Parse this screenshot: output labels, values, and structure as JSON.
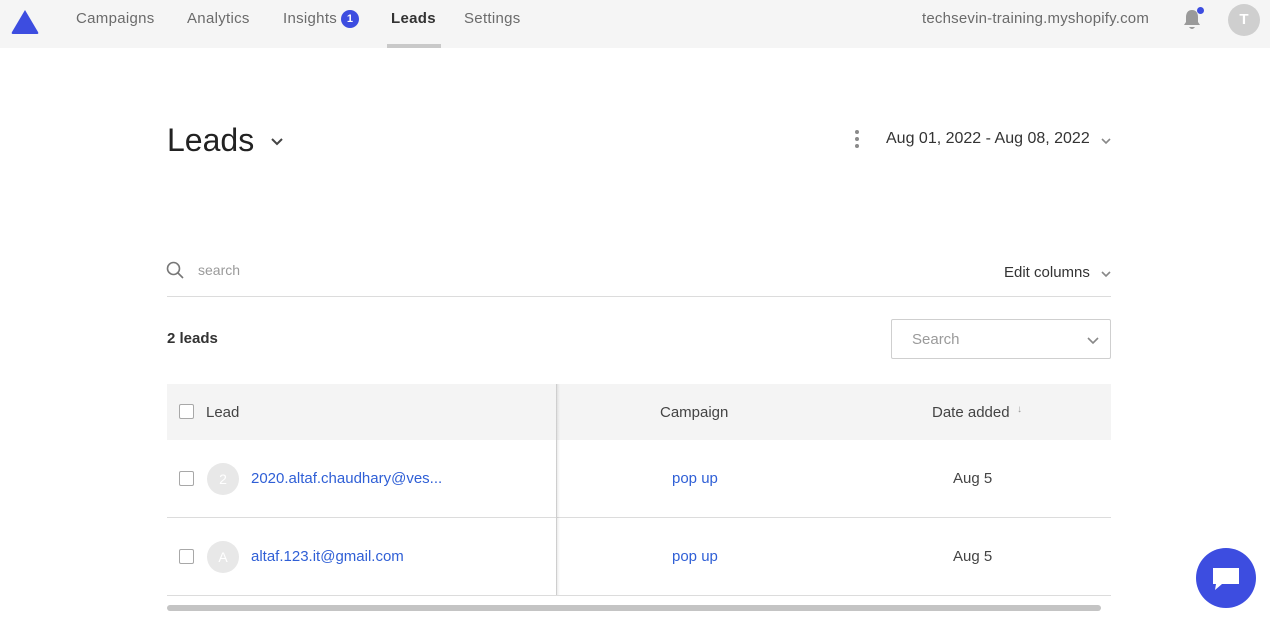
{
  "nav": {
    "items": [
      {
        "label": "Campaigns"
      },
      {
        "label": "Analytics"
      },
      {
        "label": "Insights",
        "badge": "1"
      },
      {
        "label": "Leads",
        "active": true
      },
      {
        "label": "Settings"
      }
    ],
    "store": "techsevin-training.myshopify.com",
    "avatar_initial": "T",
    "brand_color": "#3d4de0"
  },
  "header": {
    "title": "Leads",
    "date_range": "Aug 01, 2022 - Aug 08, 2022"
  },
  "toolbar": {
    "search_placeholder": "search",
    "edit_columns_label": "Edit columns"
  },
  "summary": {
    "lead_count_label": "2 leads",
    "campaign_filter_placeholder": "Search"
  },
  "table": {
    "columns": [
      "Lead",
      "Campaign",
      "Date added"
    ],
    "sort_indicator": "↓",
    "rows": [
      {
        "avatar": "2",
        "email": "2020.altaf.chaudhary@ves...",
        "campaign": "pop up",
        "date": "Aug 5"
      },
      {
        "avatar": "A",
        "email": "altaf.123.it@gmail.com",
        "campaign": "pop up",
        "date": "Aug 5"
      }
    ]
  },
  "icons": {
    "logo": "triangle-logo-icon",
    "bell": "bell-icon",
    "chat": "chat-bubble-icon",
    "search": "search-icon",
    "kebab": "kebab-menu-icon"
  }
}
